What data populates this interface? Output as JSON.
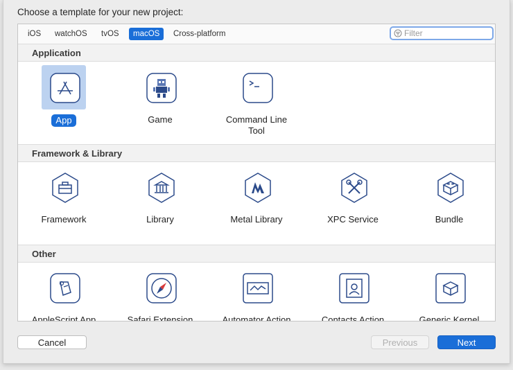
{
  "dialog": {
    "prompt": "Choose a template for your new project:"
  },
  "platform_tabs": [
    {
      "label": "iOS",
      "active": false
    },
    {
      "label": "watchOS",
      "active": false
    },
    {
      "label": "tvOS",
      "active": false
    },
    {
      "label": "macOS",
      "active": true
    },
    {
      "label": "Cross-platform",
      "active": false
    }
  ],
  "filter": {
    "placeholder": "Filter",
    "value": ""
  },
  "sections": {
    "application": {
      "title": "Application",
      "items": [
        {
          "label": "App",
          "icon": "app-store-icon",
          "selected": true
        },
        {
          "label": "Game",
          "icon": "game-robot-icon",
          "selected": false
        },
        {
          "label": "Command Line\nTool",
          "icon": "terminal-icon",
          "selected": false
        }
      ]
    },
    "framework": {
      "title": "Framework & Library",
      "items": [
        {
          "label": "Framework",
          "icon": "toolbox-icon"
        },
        {
          "label": "Library",
          "icon": "building-icon"
        },
        {
          "label": "Metal Library",
          "icon": "metal-icon"
        },
        {
          "label": "XPC Service",
          "icon": "tools-icon"
        },
        {
          "label": "Bundle",
          "icon": "lego-brick-icon"
        }
      ]
    },
    "other": {
      "title": "Other",
      "items": [
        {
          "label": "AppleScript App",
          "icon": "applescript-icon"
        },
        {
          "label": "Safari Extension",
          "icon": "compass-icon"
        },
        {
          "label": "Automator Action",
          "icon": "automator-icon"
        },
        {
          "label": "Contacts Action",
          "icon": "contacts-icon"
        },
        {
          "label": "Generic Kernel",
          "icon": "lego-brick-icon"
        }
      ]
    }
  },
  "buttons": {
    "cancel": "Cancel",
    "previous": "Previous",
    "next": "Next"
  },
  "colors": {
    "accent": "#1a6ed8",
    "selection_bg": "#bcd2f0",
    "icon_stroke": "#2b4a8a"
  }
}
